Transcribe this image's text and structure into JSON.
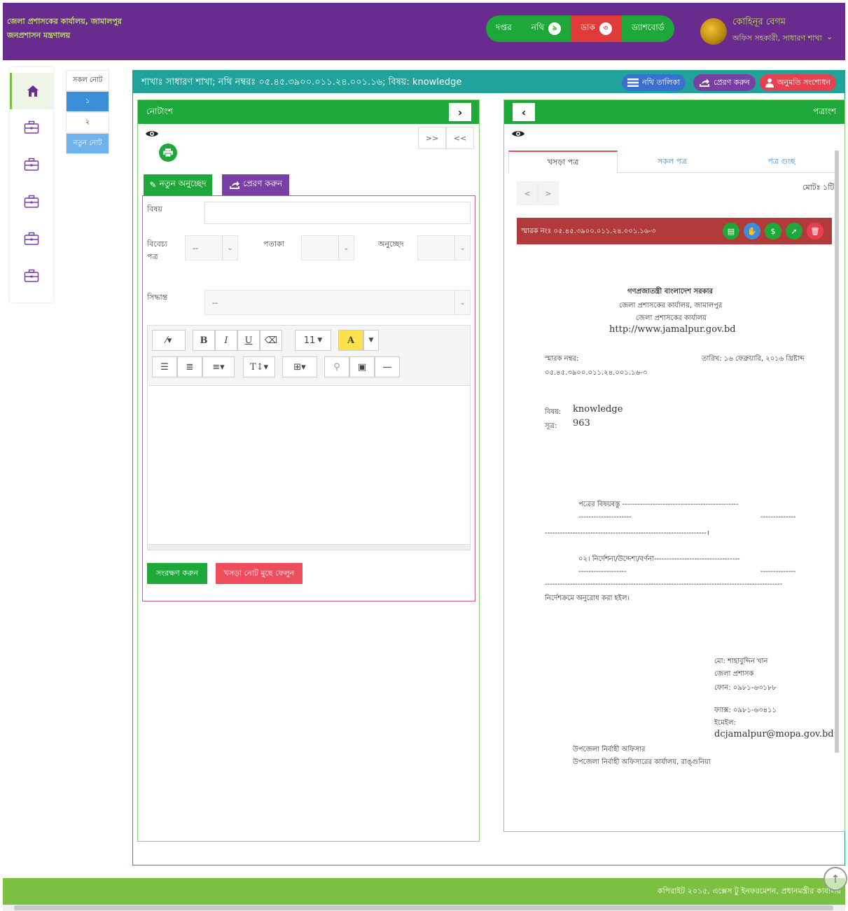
{
  "header": {
    "org_line1": "জেলা প্রশাসকের কার্যালয়, জামালপুর",
    "org_line2": "জনপ্রশাসন মন্ত্রণালয়",
    "nav": {
      "daptar": "দপ্তর",
      "nothi": "নথি",
      "nothi_count": "৯",
      "dak": "ডাক",
      "dak_count": "৩",
      "dashboard": "ড্যাশবোর্ড"
    },
    "user_name": "কোহিনূর বেগম",
    "user_role": "অফিস সহকারী, সাধারণ শাখা",
    "user_caret": "⌄"
  },
  "notelist": {
    "all": "সকল নোট",
    "items": [
      "১",
      "২"
    ],
    "new": "নতুন নোট"
  },
  "titlebar": {
    "text": "শাখাঃ সাধারণ শাখা; নথি নম্বরঃ ০৫.৪৫.৩৯০০.০১১.২৪.০০১.১৬; বিষয়: knowledge",
    "nothi_list": "নথি তালিকা",
    "send": "প্রেরণ করুন",
    "permission": "অনুমতি সংশোধন"
  },
  "note_panel": {
    "title": "নোটাংশ",
    "pager_next": ">>",
    "pager_prev": "<<",
    "new_para": "নতুন অনুচ্ছেদ",
    "send_note": "প্রেরণ করুন",
    "label_subject": "বিষয়",
    "label_letter": "বিবেচ্য পত্র",
    "label_flag": "পতাকা",
    "label_para": "অনুচ্ছেদ",
    "label_decision": "সিদ্ধান্ত",
    "select_letter": "--",
    "select_decision": "--",
    "editor": {
      "font_size": "11",
      "bold": "B",
      "italic": "I",
      "underline": "U",
      "color": "A"
    },
    "save": "সংরক্ষণ করুন",
    "delete": "খসড়া নোট মুছে ফেলুন"
  },
  "letter_panel": {
    "title": "পত্রাংশ",
    "tabs": [
      "খসড়া পত্র",
      "সকল পত্র",
      "পত্র গুচ্ছ"
    ],
    "pager_prev": "<",
    "pager_next": ">",
    "total": "মোটঃ ১টি",
    "memo_bar": "স্মারক নংঃ  ০৫.৪৫.৩৯০০.০১১.২৪.০০১.১৬-৩",
    "letter": {
      "gov": "গণপ্রজাতন্ত্রী বাংলাদেশ সরকার",
      "office": "জেলা প্রশাসকের কার্যালয়, জামালপুর",
      "office2": "জেলা প্রশাসকের কার্যালয়",
      "website": "http://www.jamalpur.gov.bd",
      "memo_label": "স্মারক নম্বর:",
      "memo_no": "০৫.৪৫.৩৯০০.০১১.২৪.০০১.১৬-৩",
      "date": "তারিখ: ১৬ ফেব্রুয়ারি, ২০১৬ খ্রিষ্টাব্দ",
      "subject_label": "বিষয়:",
      "subject": "knowledge",
      "ref_label": "সূত্র:",
      "ref": "963",
      "body1": "পত্রের বিষয়বস্তু ----------------------------------------------",
      "body1b": "---------------------",
      "body1c": "--------------",
      "body2": "----------------------------------------------------------------।",
      "body3": "০২। নির্দেশনা/উদ্দেশ্য/বর্ণনা----------------------------------",
      "body3b": "-------------------",
      "body3c": "--------------",
      "body4": "----------------------------------------------------------------------------------------------",
      "closing": "নির্দেশক্রমে অনুরোধ করা হইল।",
      "sign_name": "মো: শাহাবুদ্দিন খান",
      "sign_title": "জেলা প্রশাসক",
      "sign_phone": "ফোন: ০৯৮১-৬৩১৮৮",
      "sign_fax": "ফ্যাক্স: ০৯৮১-৬৩৪১১",
      "sign_email_label": "ইমেইল:",
      "sign_email": "dcjamalpur@mopa.gov.bd",
      "to_title": "উপজেলা নির্বাহী অফিসার",
      "to_office": "উপজেলা নির্বাহী অফিসারের কার্যালয়, রাঙ্গুনিয়া"
    }
  },
  "footer": {
    "copyright": "কপিরাইট ২০১৫, এক্সেস টু ইনফরমেশন, প্রধানমন্ত্রীর কার্যালয়"
  },
  "colors": {
    "header_bg": "#6a2b8f",
    "accent_green": "#1fa83a",
    "teal": "#1fa39a",
    "footer_bg": "#7bc043"
  }
}
